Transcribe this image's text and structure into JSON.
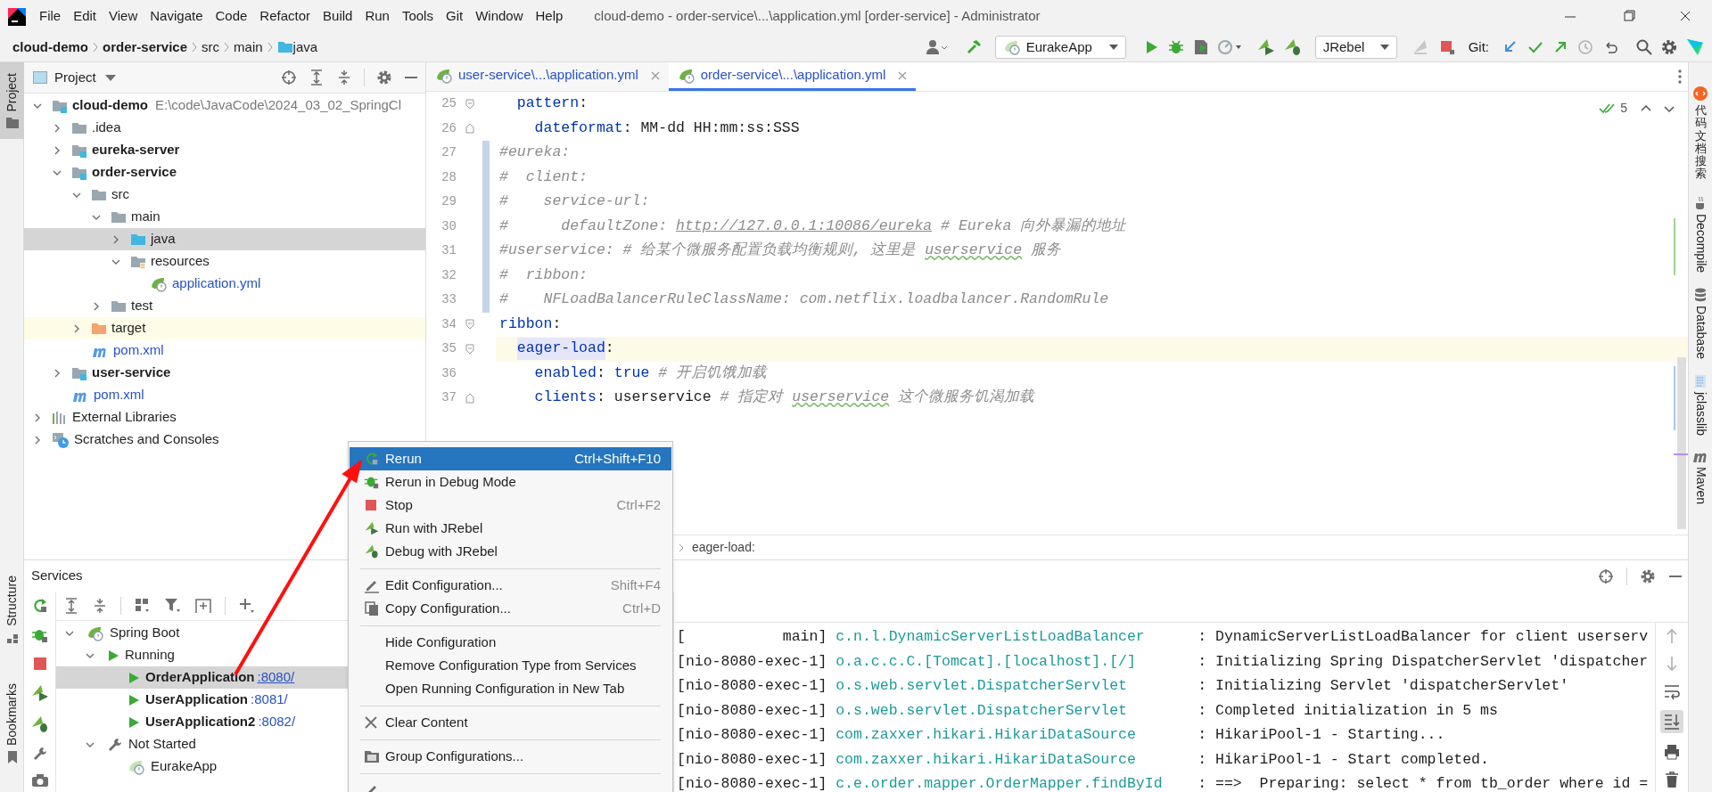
{
  "title_bar": {
    "menu": [
      "File",
      "Edit",
      "View",
      "Navigate",
      "Code",
      "Refactor",
      "Build",
      "Run",
      "Tools",
      "Git",
      "Window",
      "Help"
    ],
    "title": "cloud-demo - order-service\\...\\application.yml [order-service] - Administrator"
  },
  "nav_bar": {
    "breadcrumbs": [
      {
        "label": "cloud-demo",
        "kind": "project"
      },
      {
        "label": "order-service",
        "kind": "project"
      },
      {
        "label": "src",
        "kind": "folder"
      },
      {
        "label": "main",
        "kind": "folder"
      },
      {
        "label": "java",
        "kind": "source"
      }
    ],
    "run_config": "EurakeApp",
    "jrebel": "JRebel",
    "git_label": "Git:"
  },
  "left_strip": {
    "top": [
      {
        "label": "Project",
        "selected": true
      }
    ],
    "bottom": [
      {
        "label": "Structure",
        "selected": false
      },
      {
        "label": "Bookmarks",
        "selected": false
      }
    ]
  },
  "project": {
    "title": "Project",
    "tree": [
      {
        "label": "cloud-demo",
        "kind": "module",
        "note": "E:\\code\\JavaCode\\2024_03_02_SpringCl",
        "expanded": true,
        "selected": false,
        "children": [
          {
            "label": ".idea",
            "kind": "folder",
            "expanded": false,
            "selected": false
          },
          {
            "label": "eureka-server",
            "kind": "module",
            "expanded": false,
            "selected": false
          },
          {
            "label": "order-service",
            "kind": "module",
            "expanded": true,
            "selected": false,
            "children": [
              {
                "label": "src",
                "kind": "folder",
                "expanded": true,
                "selected": false,
                "children": [
                  {
                    "label": "main",
                    "kind": "folder",
                    "expanded": true,
                    "selected": false,
                    "children": [
                      {
                        "label": "java",
                        "kind": "source",
                        "expanded": false,
                        "selected": true
                      },
                      {
                        "label": "resources",
                        "kind": "resources",
                        "expanded": true,
                        "selected": false,
                        "children": [
                          {
                            "label": "application.yml",
                            "kind": "yml",
                            "selected": false
                          }
                        ]
                      }
                    ]
                  },
                  {
                    "label": "test",
                    "kind": "folder",
                    "expanded": false,
                    "selected": false
                  }
                ]
              },
              {
                "label": "target",
                "kind": "excluded",
                "expanded": false,
                "selected": false
              },
              {
                "label": "pom.xml",
                "kind": "maven",
                "selected": false
              }
            ]
          },
          {
            "label": "user-service",
            "kind": "module",
            "expanded": false,
            "selected": false
          },
          {
            "label": "pom.xml",
            "kind": "maven",
            "selected": false
          }
        ]
      },
      {
        "label": "External Libraries",
        "kind": "libraries",
        "expanded": false,
        "selected": false
      },
      {
        "label": "Scratches and Consoles",
        "kind": "scratches",
        "expanded": false,
        "selected": false
      }
    ]
  },
  "editor": {
    "tabs": [
      {
        "label": "user-service\\...\\application.yml",
        "selected": false
      },
      {
        "label": "order-service\\...\\application.yml",
        "selected": true
      }
    ],
    "lines": [
      {
        "number": "25",
        "fold_start": true,
        "fold_end": false,
        "modified": false,
        "current": false,
        "parts": [
          {
            "text": "  pattern",
            "kind": "key"
          },
          {
            "text": ":",
            "kind": "punct"
          }
        ]
      },
      {
        "number": "26",
        "fold_start": false,
        "fold_end": true,
        "modified": false,
        "current": false,
        "parts": [
          {
            "text": "    dateformat",
            "kind": "key"
          },
          {
            "text": ": MM-dd HH:mm:ss:SSS",
            "kind": "value"
          }
        ]
      },
      {
        "number": "27",
        "fold_start": false,
        "fold_end": false,
        "modified": true,
        "current": false,
        "parts": [
          {
            "text": "#eureka:",
            "kind": "comment"
          }
        ]
      },
      {
        "number": "28",
        "fold_start": false,
        "fold_end": false,
        "modified": true,
        "current": false,
        "parts": [
          {
            "text": "#  client:",
            "kind": "comment"
          }
        ]
      },
      {
        "number": "29",
        "fold_start": false,
        "fold_end": false,
        "modified": true,
        "current": false,
        "parts": [
          {
            "text": "#    service-url:",
            "kind": "comment"
          }
        ]
      },
      {
        "number": "30",
        "fold_start": false,
        "fold_end": false,
        "modified": true,
        "current": false,
        "parts": [
          {
            "text": "#      defaultZone: ",
            "kind": "comment"
          },
          {
            "text": "http://127.0.0.1:10086/eureka",
            "kind": "link"
          },
          {
            "text": " # Eureka 向外暴漏的地址",
            "kind": "comment"
          }
        ]
      },
      {
        "number": "31",
        "fold_start": false,
        "fold_end": false,
        "modified": true,
        "current": false,
        "parts": [
          {
            "text": "#userservice: # 给某个微服务配置负载均衡规则, 这里是 ",
            "kind": "comment"
          },
          {
            "text": "userservice",
            "kind": "typo"
          },
          {
            "text": " 服务",
            "kind": "comment"
          }
        ]
      },
      {
        "number": "32",
        "fold_start": false,
        "fold_end": false,
        "modified": true,
        "current": false,
        "parts": [
          {
            "text": "#  ribbon:",
            "kind": "comment"
          }
        ]
      },
      {
        "number": "33",
        "fold_start": false,
        "fold_end": false,
        "modified": true,
        "current": false,
        "parts": [
          {
            "text": "#    NFLoadBalancerRuleClassName: com.netflix.loadbalancer.RandomRule",
            "kind": "comment"
          }
        ]
      },
      {
        "number": "34",
        "fold_start": true,
        "fold_end": false,
        "modified": false,
        "current": false,
        "parts": [
          {
            "text": "ribbon",
            "kind": "key"
          },
          {
            "text": ":",
            "kind": "punct"
          }
        ]
      },
      {
        "number": "35",
        "fold_start": true,
        "fold_end": false,
        "modified": false,
        "current": true,
        "parts": [
          {
            "text": "  eager-load",
            "kind": "key-mark"
          },
          {
            "text": ":",
            "kind": "punct"
          }
        ]
      },
      {
        "number": "36",
        "fold_start": false,
        "fold_end": false,
        "modified": false,
        "current": false,
        "parts": [
          {
            "text": "    enabled",
            "kind": "key"
          },
          {
            "text": ": ",
            "kind": "punct"
          },
          {
            "text": "true",
            "kind": "bool"
          },
          {
            "text": " # 开启饥饿加载",
            "kind": "comment"
          }
        ]
      },
      {
        "number": "37",
        "fold_start": false,
        "fold_end": true,
        "modified": false,
        "current": false,
        "parts": [
          {
            "text": "    clients",
            "kind": "key"
          },
          {
            "text": ": userservice ",
            "kind": "value"
          },
          {
            "text": "# 指定对 ",
            "kind": "comment"
          },
          {
            "text": "userservice",
            "kind": "typo"
          },
          {
            "text": " 这个微服务饥渴加载",
            "kind": "comment"
          }
        ]
      }
    ],
    "inspections": "5",
    "breadcrumb": "eager-load:"
  },
  "right_strip": [
    {
      "label": "代码文档搜索",
      "kind": "cjk"
    },
    {
      "label": "Decompile",
      "kind": "latin"
    },
    {
      "label": "Database",
      "kind": "latin"
    },
    {
      "label": "jclasslib",
      "kind": "latin"
    },
    {
      "label": "Maven",
      "kind": "latin"
    }
  ],
  "services": {
    "title": "Services",
    "tree": [
      {
        "label": "Spring Boot",
        "kind": "group",
        "expanded": true,
        "selected": false,
        "children": [
          {
            "label": "Running",
            "kind": "running",
            "expanded": true,
            "selected": false,
            "children": [
              {
                "label": "OrderApplication",
                "port": ":8080/",
                "kind": "app",
                "selected": true
              },
              {
                "label": "UserApplication",
                "port": ":8081/",
                "kind": "app",
                "selected": false
              },
              {
                "label": "UserApplication2",
                "port": ":8082/",
                "kind": "app",
                "selected": false
              }
            ]
          },
          {
            "label": "Not Started",
            "kind": "stopped",
            "expanded": true,
            "selected": false,
            "children": [
              {
                "label": "EurakeApp",
                "kind": "idle",
                "selected": false
              }
            ]
          }
        ]
      }
    ]
  },
  "console": {
    "rows": [
      {
        "thread": "[           main]",
        "logger": "c.n.l.DynamicServerListLoadBalancer",
        "message": ": DynamicServerListLoadBalancer for client userserv"
      },
      {
        "thread": "[nio-8080-exec-1]",
        "logger": "o.a.c.c.C.[Tomcat].[localhost].[/]",
        "message": ": Initializing Spring DispatcherServlet 'dispatcher"
      },
      {
        "thread": "[nio-8080-exec-1]",
        "logger": "o.s.web.servlet.DispatcherServlet",
        "message": ": Initializing Servlet 'dispatcherServlet'"
      },
      {
        "thread": "[nio-8080-exec-1]",
        "logger": "o.s.web.servlet.DispatcherServlet",
        "message": ": Completed initialization in 5 ms"
      },
      {
        "thread": "[nio-8080-exec-1]",
        "logger": "com.zaxxer.hikari.HikariDataSource",
        "message": ": HikariPool-1 - Starting..."
      },
      {
        "thread": "[nio-8080-exec-1]",
        "logger": "com.zaxxer.hikari.HikariDataSource",
        "message": ": HikariPool-1 - Start completed."
      },
      {
        "thread": "[nio-8080-exec-1]",
        "logger": "c.e.order.mapper.OrderMapper.findById",
        "message": ": ==>  Preparing: select * from tb_order where id ="
      }
    ]
  },
  "context_menu": {
    "items": [
      {
        "kind": "item",
        "label": "Rerun",
        "shortcut": "Ctrl+Shift+F10",
        "selected": true
      },
      {
        "kind": "item",
        "label": "Rerun in Debug Mode",
        "selected": false
      },
      {
        "kind": "item",
        "label": "Stop",
        "shortcut": "Ctrl+F2",
        "selected": false
      },
      {
        "kind": "item",
        "label": "Run with JRebel",
        "selected": false
      },
      {
        "kind": "item",
        "label": "Debug with JRebel",
        "selected": false
      },
      {
        "kind": "separator"
      },
      {
        "kind": "item",
        "label": "Edit Configuration...",
        "shortcut": "Shift+F4",
        "selected": false
      },
      {
        "kind": "item",
        "label": "Copy Configuration...",
        "shortcut": "Ctrl+D",
        "selected": false
      },
      {
        "kind": "separator"
      },
      {
        "kind": "item",
        "label": "Hide Configuration",
        "selected": false
      },
      {
        "kind": "item",
        "label": "Remove Configuration Type from Services",
        "selected": false
      },
      {
        "kind": "item",
        "label": "Open Running Configuration in New Tab",
        "selected": false
      },
      {
        "kind": "separator"
      },
      {
        "kind": "item",
        "label": "Clear Content",
        "selected": false
      },
      {
        "kind": "separator"
      },
      {
        "kind": "item",
        "label": "Group Configurations...",
        "selected": false
      },
      {
        "kind": "separator"
      }
    ]
  }
}
